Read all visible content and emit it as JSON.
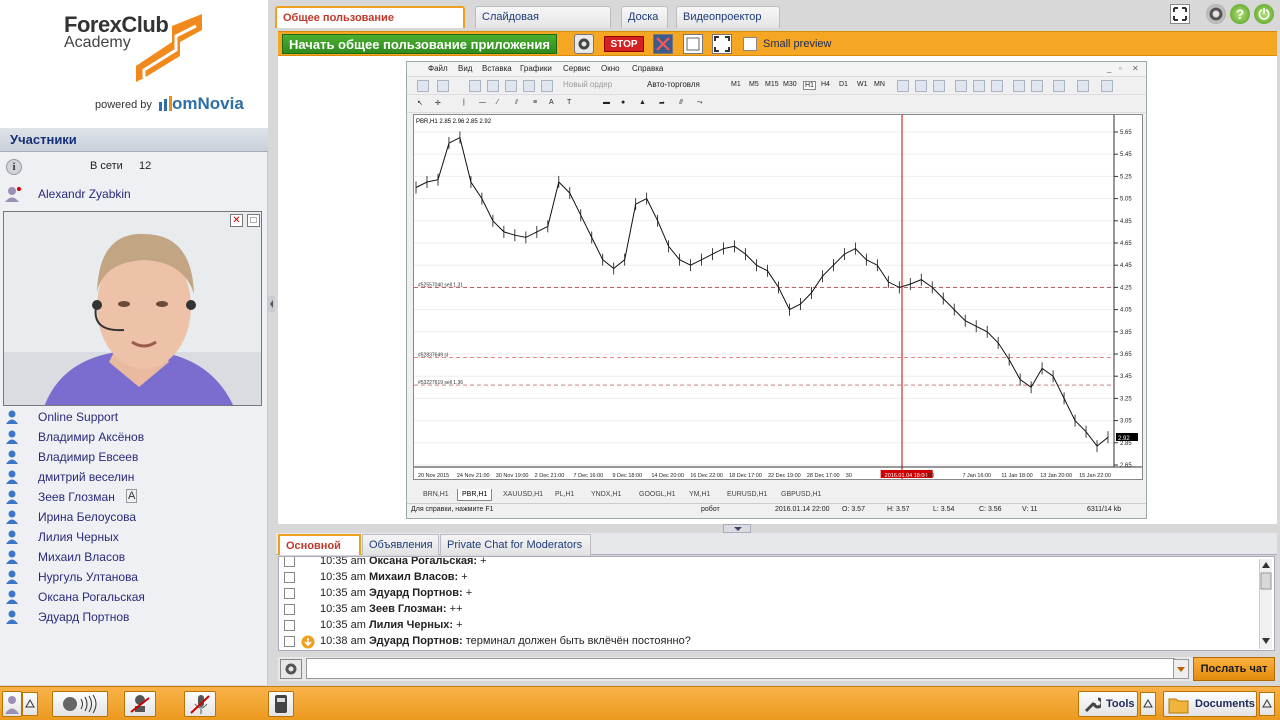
{
  "logo": {
    "line1": "ForexClub",
    "line2": "Academy",
    "powered_by": "powered by",
    "vendor": "omNovia"
  },
  "participants": {
    "title": "Участники",
    "online_label": "В сети",
    "online_count": "12",
    "presenter": "Alexandr Zyabkin",
    "users": [
      {
        "name": "Online Support"
      },
      {
        "name": "Владимир Аксёнов"
      },
      {
        "name": "Владимир Евсеев"
      },
      {
        "name": "дмитрий веселин"
      },
      {
        "name": "Зеев Глозман",
        "badge": "A"
      },
      {
        "name": "Ирина Белоусова"
      },
      {
        "name": "Лилия Черных"
      },
      {
        "name": "Михаил Власов"
      },
      {
        "name": "Нургуль Ултанова"
      },
      {
        "name": "Оксана Рогальская"
      },
      {
        "name": "Эдуард Портнов"
      }
    ]
  },
  "app_tabs": [
    "Общее пользование приложения",
    "Слайдовая презентация",
    "Доска",
    "Видеопроектор"
  ],
  "sharebar": {
    "start_label": "Начать общее пользование приложения",
    "stop_label": "STOP",
    "preview_label": "Small preview"
  },
  "terminal": {
    "menu": [
      "Файл",
      "Вид",
      "Вставка",
      "Графики",
      "Сервис",
      "Окно",
      "Справка"
    ],
    "new_order": "Новый ордер",
    "auto_trading": "Авто-торговля",
    "timeframes": [
      "M1",
      "M5",
      "M15",
      "M30",
      "H1",
      "H4",
      "D1",
      "W1",
      "MN"
    ],
    "chart_title": "PBR,H1  2.85 2.96 2.85 2.92",
    "price_labels": [
      "5.65",
      "5.45",
      "5.25",
      "5.05",
      "4.85",
      "4.65",
      "4.45",
      "4.25",
      "4.05",
      "3.85",
      "3.65",
      "3.45",
      "3.25",
      "3.05",
      "2.85",
      "2.65"
    ],
    "current_price": "2.92",
    "order_lines": [
      "#52557040 sell 1.31",
      "#52837649 sl",
      "#53227619 sell 1.36"
    ],
    "time_labels": [
      "20 Nov 2015",
      "24 Nov 21:00",
      "30 Nov 19:00",
      "2 Dec 21:00",
      "7 Dec 16:00",
      "9 Dec 18:00",
      "14 Dec 20:00",
      "16 Dec 22:00",
      "18 Dec 17:00",
      "22 Dec 19:00",
      "28 Dec 17:00",
      "30",
      "2016.01.04 18:00",
      "1:00",
      "7 Jan 16:00",
      "11 Jan 18:00",
      "13 Jan 20:00",
      "15 Jan 22:00"
    ],
    "symbol_tabs": [
      "BRN,H1",
      "PBR,H1",
      "XAUUSD,H1",
      "PL,H1",
      "YNDX,H1",
      "GOOGL,H1",
      "YM,H1",
      "EURUSD,H1",
      "GBPUSD,H1"
    ],
    "status": {
      "help": "Для справки, нажмите F1",
      "profile": "робот",
      "datetime": "2016.01.14 22:00",
      "open": "O: 3.57",
      "high": "H: 3.57",
      "low": "L: 3.54",
      "close": "C: 3.56",
      "volume": "V: 11",
      "traffic": "6311/14 kb"
    }
  },
  "chat": {
    "tabs": [
      "Основной чат",
      "Объявления",
      "Private Chat for Moderators"
    ],
    "messages": [
      {
        "time": "10:35 am",
        "author": "Оксана Рогальская:",
        "text": " +"
      },
      {
        "time": "10:35 am",
        "author": "Михаил Власов:",
        "text": " +"
      },
      {
        "time": "10:35 am",
        "author": "Эдуард Портнов:",
        "text": " +"
      },
      {
        "time": "10:35 am",
        "author": "Зеев Глозман:",
        "text": " ++"
      },
      {
        "time": "10:35 am",
        "author": "Лилия Черных:",
        "text": " +"
      },
      {
        "time": "10:38 am",
        "author": "Эдуард Портнов:",
        "text": " терминал должен быть вклёчён постоянно?"
      }
    ],
    "send_label": "Послать чат",
    "input_value": ""
  },
  "bottom": {
    "tools_label": "Tools",
    "documents_label": "Documents"
  },
  "colors": {
    "accent_orange": "#f5a623",
    "start_green": "#3a9a26",
    "stop_red": "#d32020",
    "link_blue": "#2a2a7a"
  }
}
